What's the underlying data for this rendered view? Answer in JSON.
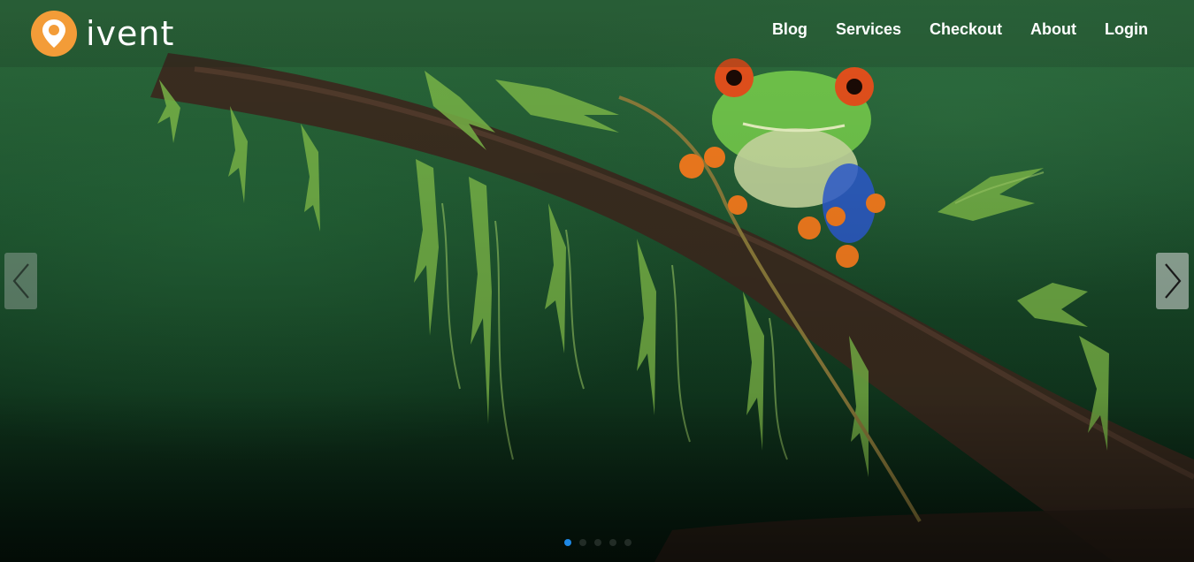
{
  "brand": {
    "name": "ivent",
    "icon": "map-pin-icon",
    "accent_color": "#f39c38"
  },
  "nav": {
    "items": [
      "Blog",
      "Services",
      "Checkout",
      "About",
      "Login"
    ]
  },
  "carousel": {
    "slide_count": 5,
    "active_index": 0,
    "active_dot_color": "#1e88e5",
    "prev_icon": "chevron-left-icon",
    "next_icon": "chevron-right-icon",
    "image_subject": "frog"
  }
}
